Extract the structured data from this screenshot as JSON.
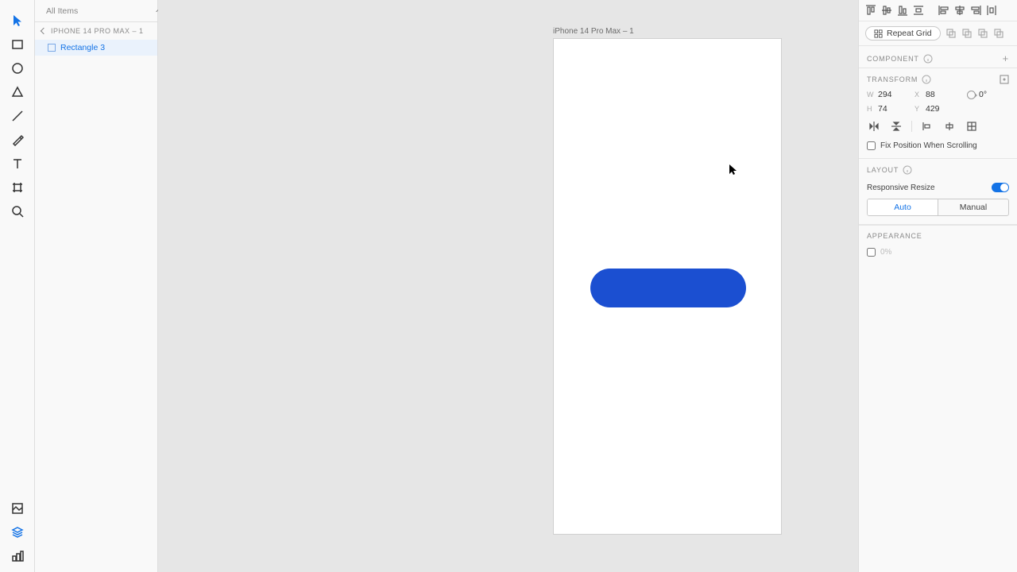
{
  "search": {
    "placeholder": "All Items"
  },
  "layers": {
    "artboard_crumb": "IPHONE 14 PRO MAX – 1",
    "selected_layer": "Rectangle 3"
  },
  "canvas": {
    "artboard_label": "iPhone 14 Pro Max – 1"
  },
  "props": {
    "repeat_label": "Repeat Grid",
    "section_component": "COMPONENT",
    "section_transform": "TRANSFORM",
    "width": "294",
    "x": "88",
    "height": "74",
    "y": "429",
    "rotation": "0°",
    "fix_label": "Fix Position When Scrolling",
    "section_layout": "LAYOUT",
    "resp_label": "Responsive Resize",
    "seg_auto": "Auto",
    "seg_manual": "Manual",
    "section_appearance": "APPEARANCE",
    "opacity_label": "0%"
  }
}
